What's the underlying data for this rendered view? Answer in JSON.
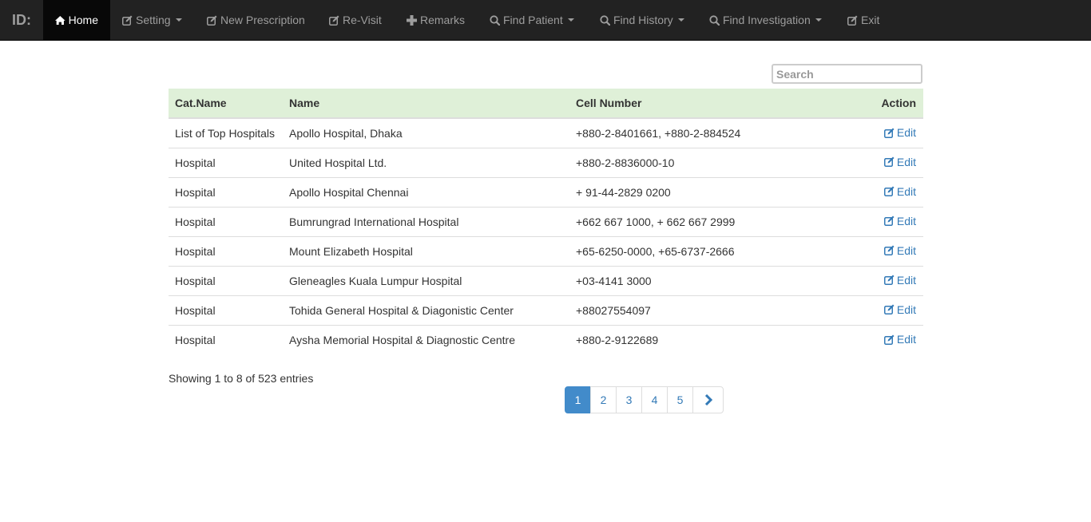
{
  "navbar": {
    "brand": "ID:",
    "items": [
      {
        "label": "Home",
        "icon": "home-icon"
      },
      {
        "label": "Setting",
        "icon": "edit-icon",
        "dropdown": true
      },
      {
        "label": "New Prescription",
        "icon": "edit-icon"
      },
      {
        "label": "Re-Visit",
        "icon": "edit-icon"
      },
      {
        "label": "Remarks",
        "icon": "plus-icon"
      },
      {
        "label": "Find Patient",
        "icon": "search-icon",
        "dropdown": true
      },
      {
        "label": "Find History",
        "icon": "search-icon",
        "dropdown": true
      },
      {
        "label": "Find Investigation",
        "icon": "search-icon",
        "dropdown": true
      },
      {
        "label": "Exit",
        "icon": "edit-icon"
      }
    ]
  },
  "search": {
    "placeholder": "Search",
    "value": ""
  },
  "table": {
    "headers": {
      "cat": "Cat.Name",
      "name": "Name",
      "cell": "Cell Number",
      "action": "Action"
    },
    "action_label": "Edit",
    "rows": [
      {
        "cat": "List of Top Hospitals",
        "name": "Apollo Hospital, Dhaka",
        "cell": "+880-2-8401661, +880-2-884524"
      },
      {
        "cat": "Hospital",
        "name": "United Hospital Ltd.",
        "cell": "+880-2-8836000-10"
      },
      {
        "cat": "Hospital",
        "name": "Apollo Hospital Chennai",
        "cell": "+ 91-44-2829 0200"
      },
      {
        "cat": "Hospital",
        "name": "Bumrungrad International Hospital",
        "cell": "+662 667 1000, + 662 667 2999"
      },
      {
        "cat": "Hospital",
        "name": "Mount Elizabeth Hospital",
        "cell": "+65-6250-0000, +65-6737-2666"
      },
      {
        "cat": "Hospital",
        "name": "Gleneagles Kuala Lumpur Hospital",
        "cell": "+03-4141 3000"
      },
      {
        "cat": "Hospital",
        "name": "Tohida General Hospital & Diagonistic Center",
        "cell": "+88027554097"
      },
      {
        "cat": "Hospital",
        "name": "Aysha Memorial Hospital & Diagnostic Centre",
        "cell": "+880-2-9122689"
      }
    ]
  },
  "footer": {
    "info": "Showing 1 to 8 of 523 entries"
  },
  "pagination": {
    "pages": [
      "1",
      "2",
      "3",
      "4",
      "5"
    ],
    "active": "1",
    "next_icon": "chevron-right-icon"
  },
  "colors": {
    "navbar_bg": "#222222",
    "header_bg": "#dff0d8",
    "link": "#337ab7",
    "active_page": "#428bca"
  }
}
